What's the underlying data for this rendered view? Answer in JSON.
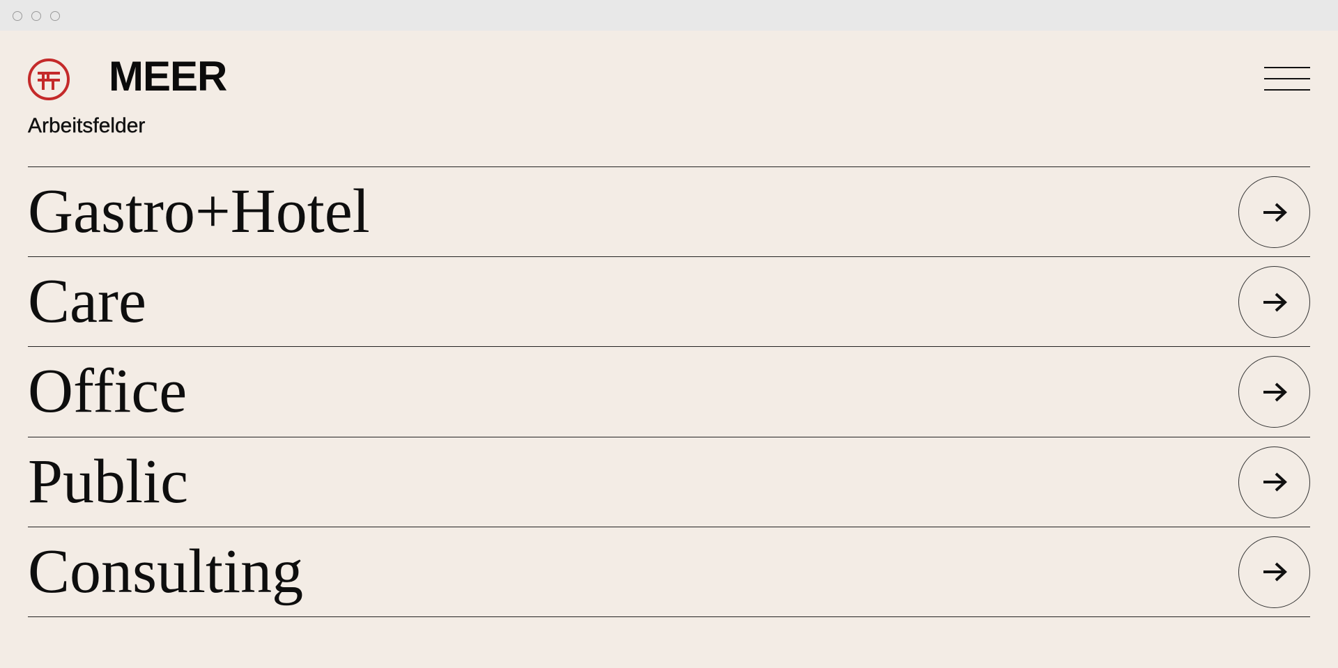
{
  "header": {
    "brand": "MEER",
    "logo_icon": "meer-logo-icon",
    "menu_icon": "hamburger-menu-icon"
  },
  "section": {
    "label": "Arbeitsfelder"
  },
  "fields": [
    {
      "label": "Gastro+Hotel",
      "icon": "arrow-right-icon"
    },
    {
      "label": "Care",
      "icon": "arrow-right-icon"
    },
    {
      "label": "Office",
      "icon": "arrow-right-icon"
    },
    {
      "label": "Public",
      "icon": "arrow-right-icon"
    },
    {
      "label": "Consulting",
      "icon": "arrow-right-icon"
    }
  ],
  "colors": {
    "background": "#f3ece5",
    "logo_red": "#c42a2a",
    "text": "#111111"
  }
}
